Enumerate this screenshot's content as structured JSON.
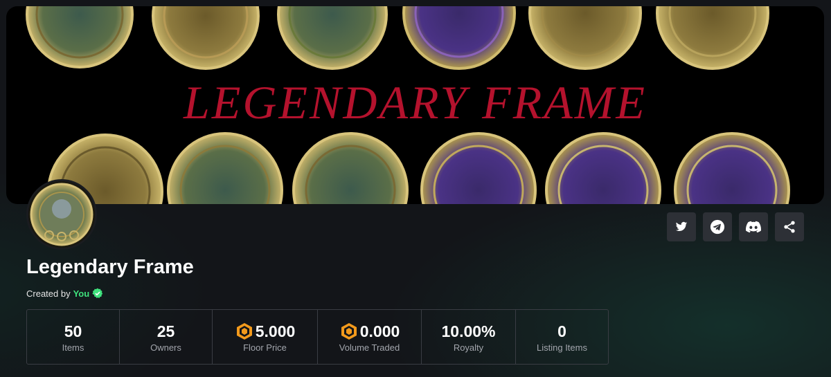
{
  "banner": {
    "title": "LEGENDARY FRAME"
  },
  "collection": {
    "name": "Legendary Frame",
    "created_by_label": "Created by",
    "creator": "You",
    "verified_icon": "verified-check-icon"
  },
  "socials": [
    {
      "icon": "twitter-icon"
    },
    {
      "icon": "telegram-icon"
    },
    {
      "icon": "discord-icon"
    },
    {
      "icon": "share-icon"
    }
  ],
  "stats": [
    {
      "value": "50",
      "label": "Items",
      "icon": null
    },
    {
      "value": "25",
      "label": "Owners",
      "icon": null
    },
    {
      "value": "5.000",
      "label": "Floor Price",
      "icon": "token-cube-icon"
    },
    {
      "value": "0.000",
      "label": "Volume Traded",
      "icon": "token-cube-icon"
    },
    {
      "value": "10.00%",
      "label": "Royalty",
      "icon": null
    },
    {
      "value": "0",
      "label": "Listing Items",
      "icon": null
    }
  ],
  "colors": {
    "banner_title": "#b4122d",
    "creator_name": "#3fe27d",
    "token_orange": "#f39a1c",
    "verified": "#3fe27d"
  }
}
